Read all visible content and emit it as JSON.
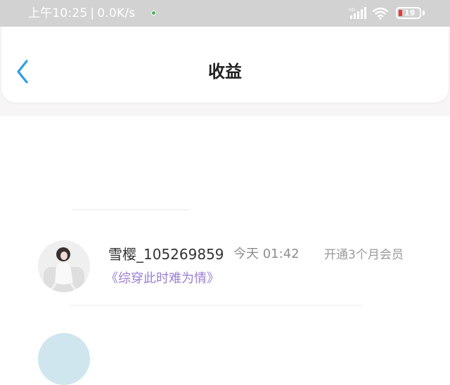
{
  "status_bar": {
    "time": "上午10:25",
    "separator": "|",
    "network_speed": "0.0K/s",
    "network_type": "HD",
    "battery_level": "19",
    "icons": [
      "signal-icon",
      "wifi-icon",
      "battery-icon"
    ]
  },
  "header": {
    "back_icon": "chevron-left-icon",
    "title": "收益"
  },
  "earnings": [
    {
      "username": "雪樱_105269859",
      "time": "今天 01:42",
      "type": "开通3个月会员",
      "book": "《综穿此时难为情》"
    }
  ],
  "colors": {
    "status_bar": "#d2d2d2",
    "accent": "#2aa0e6",
    "book_link": "#9b7fd1",
    "battery_low": "#e53935"
  }
}
